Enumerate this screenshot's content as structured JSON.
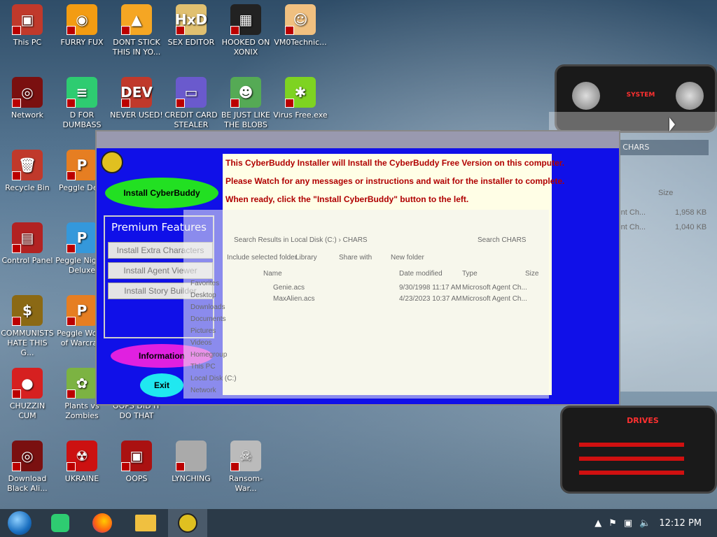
{
  "desktop_icons": [
    {
      "label": "This PC",
      "color": "#c0392b",
      "glyph": "▣"
    },
    {
      "label": "FURRY FUX",
      "color": "#f39c12",
      "glyph": "◉"
    },
    {
      "label": "DONT STICK THIS IN YO...",
      "color": "#f5a623",
      "glyph": "▲"
    },
    {
      "label": "SEX EDITOR",
      "color": "#e0c070",
      "glyph": "HxD"
    },
    {
      "label": "HOOKED ON XONIX",
      "color": "#222",
      "glyph": "▦"
    },
    {
      "label": "VM0Technic...",
      "color": "#f0c080",
      "glyph": "☺"
    },
    {
      "label": "Network",
      "color": "#7a1010",
      "glyph": "◎"
    },
    {
      "label": "D FOR DUMBASS",
      "color": "#2ecc71",
      "glyph": "≡"
    },
    {
      "label": "NEVER USED!",
      "color": "#c0392b",
      "glyph": "DEV"
    },
    {
      "label": "CREDIT CARD STEALER",
      "color": "#6a5acd",
      "glyph": "▭"
    },
    {
      "label": "BE JUST LIKE THE BLOBS",
      "color": "#55aa55",
      "glyph": "☻"
    },
    {
      "label": "Virus Free.exe",
      "color": "#7ed321",
      "glyph": "✱"
    },
    {
      "label": "Recycle Bin",
      "color": "#c0392b",
      "glyph": "🗑"
    },
    {
      "label": "Peggle De...",
      "color": "#e67e22",
      "glyph": "P"
    },
    {
      "label": "Control Panel",
      "color": "#b22222",
      "glyph": "▤"
    },
    {
      "label": "Peggle Nights Deluxe",
      "color": "#3498db",
      "glyph": "P"
    },
    {
      "label": "COMMUNISTS HATE THIS G...",
      "color": "#8b6914",
      "glyph": "$"
    },
    {
      "label": "Peggle World of Warcraft",
      "color": "#e67e22",
      "glyph": "P"
    },
    {
      "label": "CHUZZIN CUM",
      "color": "#d62020",
      "glyph": "●"
    },
    {
      "label": "Plants vs Zombies",
      "color": "#7cb342",
      "glyph": "✿"
    },
    {
      "label": "OOPS DID IT DO THAT",
      "color": "#666",
      "glyph": ""
    },
    {
      "label": "Download Black Ali...",
      "color": "#7a1010",
      "glyph": "◎"
    },
    {
      "label": "UKRAINE",
      "color": "#cc1111",
      "glyph": "☢"
    },
    {
      "label": "OOPS",
      "color": "#aa1111",
      "glyph": "▣"
    },
    {
      "label": "LYNCHING",
      "color": "#aaa",
      "glyph": ""
    },
    {
      "label": "Ransom-War...",
      "color": "#bbb",
      "glyph": "☠"
    }
  ],
  "taskbar": {
    "clock": "12:12 PM",
    "apps": [
      "start-orb",
      "notes",
      "firefox",
      "file-explorer",
      "cyberbuddy"
    ]
  },
  "installer": {
    "install_button": "Install CyberBuddy",
    "premium_title": "Premium Features",
    "premium_buttons": [
      "Install Extra Characters",
      "Install Agent Viewer",
      "Install Story Builder"
    ],
    "info_button": "Information",
    "exit_button": "Exit",
    "messages": [
      "This CyberBuddy Installer will Install the CyberBuddy Free Version on this computer.",
      "Please Watch for any messages or instructions and wait for the installer to complete.",
      "When ready, click the \"Install CyberBuddy\" button to the left."
    ]
  },
  "explorer": {
    "search_placeholder": "Search CHARS",
    "breadcrumb": "Search Results in Local Disk (C:) › CHARS",
    "toolbar": [
      "Include selected folder",
      "Library",
      "Share with",
      "New folder"
    ],
    "columns": [
      "Name",
      "Date modified",
      "Type",
      "Size"
    ],
    "nav": [
      "Favorites",
      "Desktop",
      "Downloads",
      "Documents",
      "Pictures",
      "Videos",
      "Homegroup",
      "This PC",
      "Local Disk (C:)",
      "Network"
    ],
    "rows": [
      {
        "name": "Genie.acs",
        "date": "9/30/1998 11:17 AM",
        "type": "Microsoft Agent Ch...",
        "size": "1,958 KB"
      },
      {
        "name": "MaxAlien.acs",
        "date": "4/23/2023 10:37 AM",
        "type": "Microsoft Agent Ch...",
        "size": "1,040 KB"
      }
    ]
  },
  "alien_widget": {
    "drives_label": "DRIVES",
    "title_label": "SYSTEM"
  },
  "colors": {
    "installer_bg": "#1010e8",
    "message_text": "#b00000",
    "install_pill": "#22e022",
    "info_pill": "#e020e0",
    "exit_pill": "#20e8f0"
  }
}
